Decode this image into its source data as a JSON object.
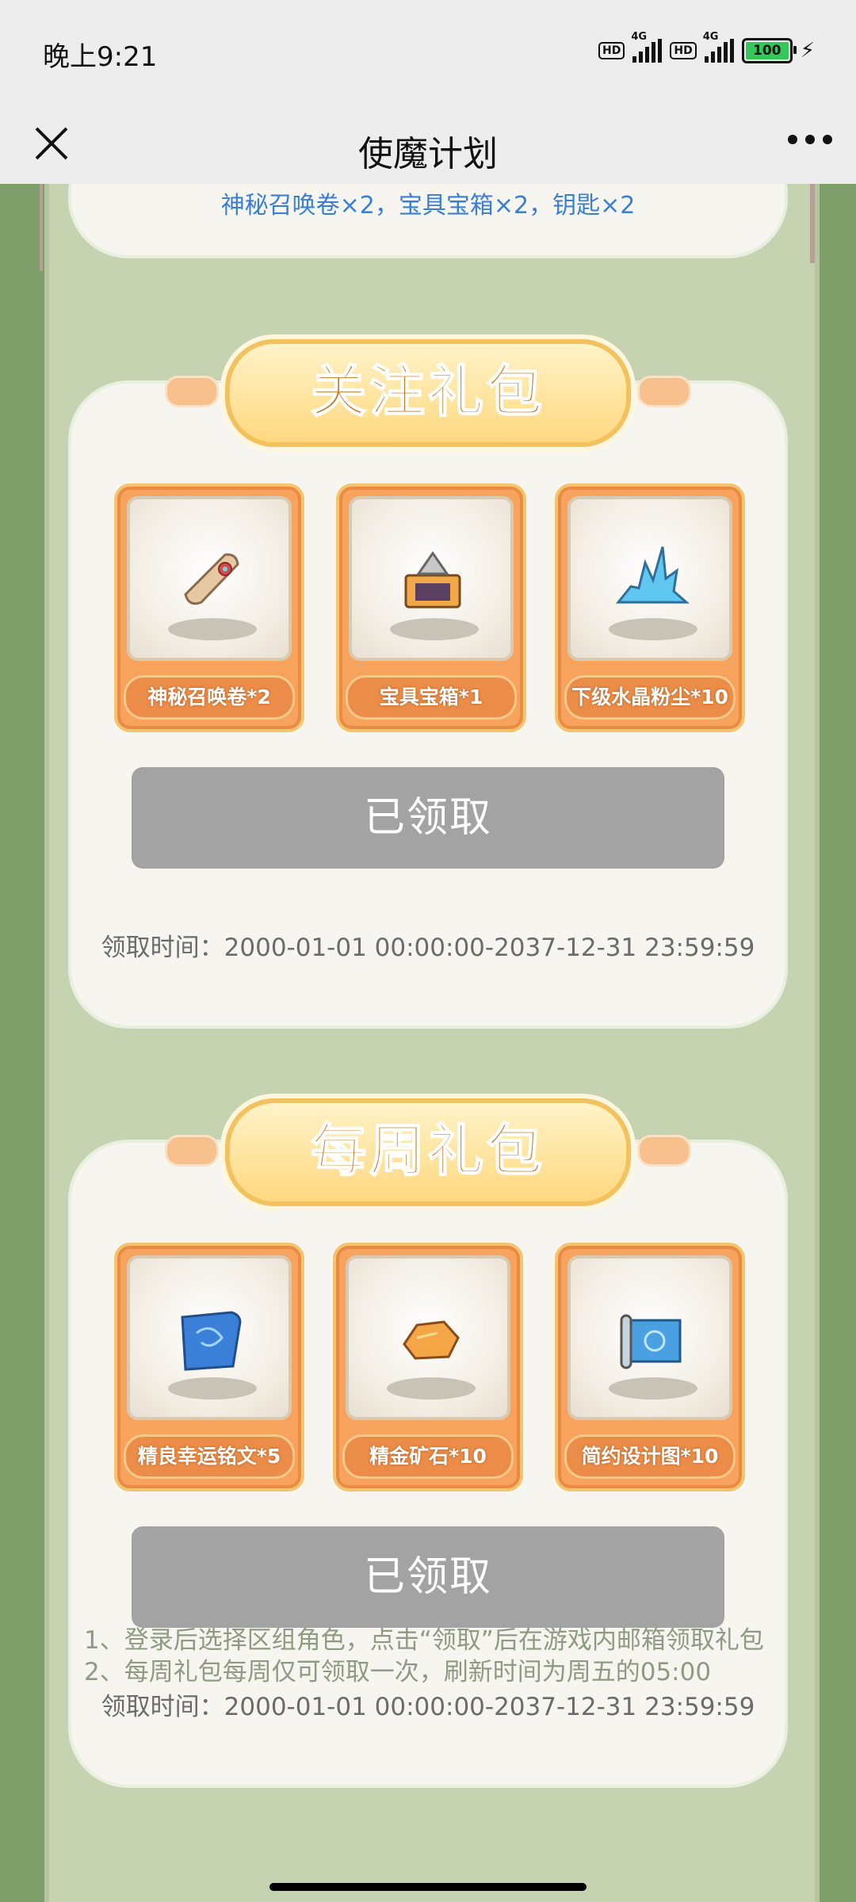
{
  "status_bar": {
    "time": "晚上9:21",
    "hd1": "HD",
    "net1": "4G",
    "hd2": "HD",
    "net2": "4G",
    "battery": "100"
  },
  "title_bar": {
    "title": "使魔计划"
  },
  "top_card": {
    "reward_text": "神秘召唤卷×2，宝具宝箱×2，钥匙×2"
  },
  "follow_pack": {
    "title": "关注礼包",
    "items": [
      {
        "label": "神秘召唤卷*2",
        "icon": "scroll-icon"
      },
      {
        "label": "宝具宝箱*1",
        "icon": "treasure-chest-icon"
      },
      {
        "label": "下级水晶粉尘*10",
        "icon": "crystal-dust-icon"
      }
    ],
    "button_label": "已领取",
    "claim_time": "领取时间：2000-01-01 00:00:00-2037-12-31 23:59:59"
  },
  "weekly_pack": {
    "title": "每周礼包",
    "items": [
      {
        "label": "精良幸运铭文*5",
        "icon": "inscription-scroll-icon"
      },
      {
        "label": "精金矿石*10",
        "icon": "gold-ore-icon"
      },
      {
        "label": "简约设计图*10",
        "icon": "blueprint-icon"
      }
    ],
    "button_label": "已领取",
    "claim_time": "领取时间：2000-01-01 00:00:00-2037-12-31 23:59:59"
  },
  "notes": [
    "1、登录后选择区组角色，点击“领取”后在游戏内邮箱领取礼包",
    "2、每周礼包每周仅可领取一次，刷新时间为周五的05:00"
  ],
  "colors": {
    "background": "#7e9e6a",
    "panel": "#c6d3b0",
    "card": "#f6f5f0",
    "item_orange": "#f7a35e",
    "button_disabled": "#a3a3a3",
    "link_blue": "#3a7fd0"
  }
}
